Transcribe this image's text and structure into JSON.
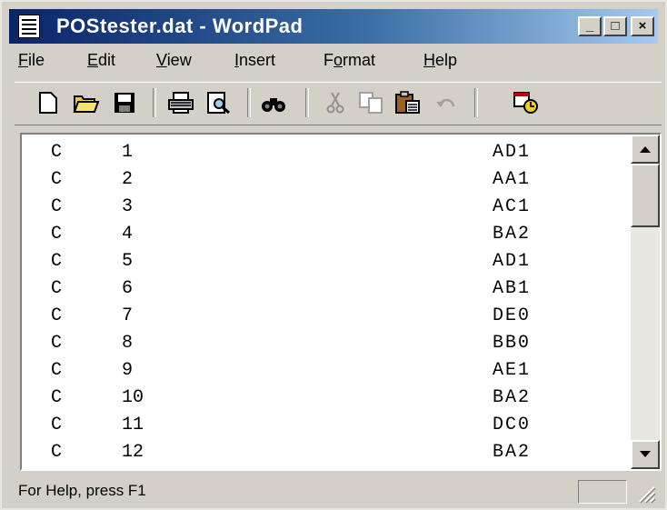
{
  "window": {
    "title": "POStester.dat - WordPad",
    "minimize": "_",
    "maximize": "□",
    "close": "×"
  },
  "menu": {
    "items": [
      {
        "label": "File",
        "hotkey": "F",
        "rest": "ile"
      },
      {
        "label": "Edit",
        "hotkey": "E",
        "rest": "dit"
      },
      {
        "label": "View",
        "hotkey": "V",
        "rest": "iew"
      },
      {
        "label": "Insert",
        "hotkey": "I",
        "rest": "nsert"
      },
      {
        "label": "Format",
        "hotkey": "o",
        "pre": "F",
        "rest": "rmat"
      },
      {
        "label": "Help",
        "hotkey": "H",
        "rest": "elp"
      }
    ]
  },
  "toolbar": {
    "icons": [
      "new-icon",
      "open-icon",
      "save-icon",
      "print-icon",
      "print-preview-icon",
      "find-icon",
      "cut-icon",
      "copy-icon",
      "paste-icon",
      "undo-icon",
      "date-time-icon"
    ]
  },
  "document": {
    "rows": [
      {
        "c": "C",
        "n": "1",
        "code": "AD1"
      },
      {
        "c": "C",
        "n": "2",
        "code": "AA1"
      },
      {
        "c": "C",
        "n": "3",
        "code": "AC1"
      },
      {
        "c": "C",
        "n": "4",
        "code": "BA2"
      },
      {
        "c": "C",
        "n": "5",
        "code": "AD1"
      },
      {
        "c": "C",
        "n": "6",
        "code": "AB1"
      },
      {
        "c": "C",
        "n": "7",
        "code": "DE0"
      },
      {
        "c": "C",
        "n": "8",
        "code": "BB0"
      },
      {
        "c": "C",
        "n": "9",
        "code": "AE1"
      },
      {
        "c": "C",
        "n": "10",
        "code": "BA2"
      },
      {
        "c": "C",
        "n": "11",
        "code": "DC0"
      },
      {
        "c": "C",
        "n": "12",
        "code": "BA2"
      }
    ]
  },
  "status": {
    "text": "For Help, press F1"
  },
  "colors": {
    "title_start": "#0a246a",
    "title_end": "#a6caf0",
    "face": "#d4d0c8"
  }
}
